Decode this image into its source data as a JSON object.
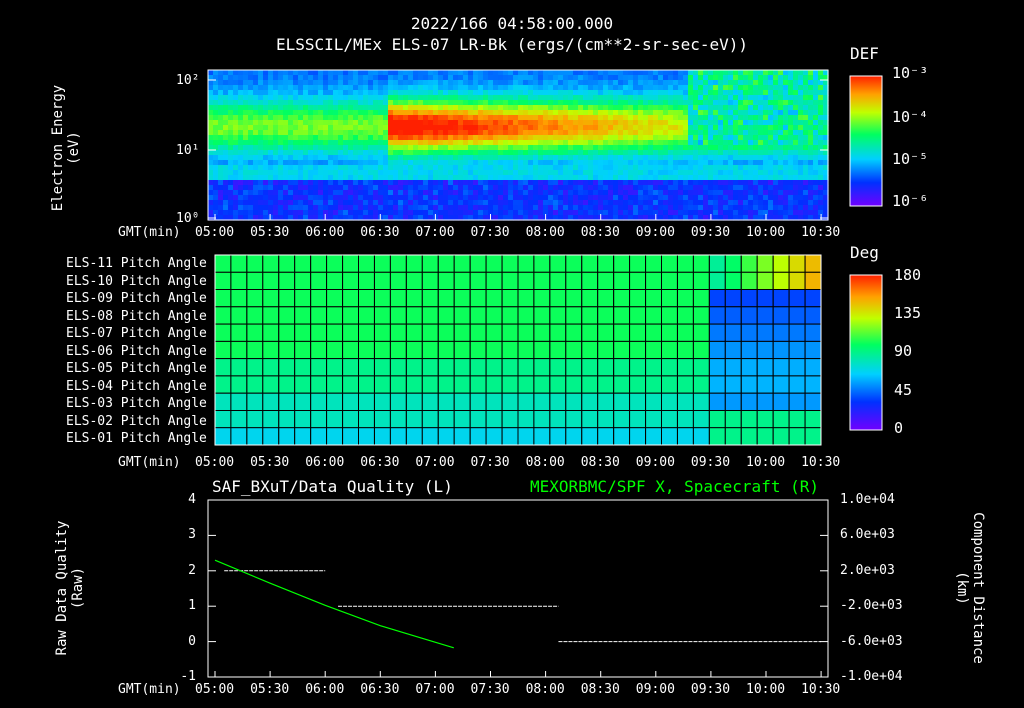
{
  "header": {
    "datetime": "2022/166 04:58:00.000",
    "title": "ELSSCIL/MEx ELS-07 LR-Bk  (ergs/(cm**2-sr-sec-eV))"
  },
  "panel1": {
    "ylabel_line1": "Electron Energy",
    "ylabel_line2": "(eV)",
    "yticks": [
      "10²",
      "10¹",
      "10⁰"
    ],
    "colorbar": {
      "title": "DEF",
      "labels": [
        "10⁻³",
        "10⁻⁴",
        "10⁻⁵",
        "10⁻⁶"
      ]
    }
  },
  "panel2": {
    "rows": [
      "ELS-11 Pitch Angle",
      "ELS-10 Pitch Angle",
      "ELS-09 Pitch Angle",
      "ELS-08 Pitch Angle",
      "ELS-07 Pitch Angle",
      "ELS-06 Pitch Angle",
      "ELS-05 Pitch Angle",
      "ELS-04 Pitch Angle",
      "ELS-03 Pitch Angle",
      "ELS-02 Pitch Angle",
      "ELS-01 Pitch Angle"
    ],
    "colorbar": {
      "title": "Deg",
      "labels": [
        "180",
        "135",
        "90",
        "45",
        "0"
      ]
    }
  },
  "panel3": {
    "title_left": "SAF_BXuT/Data Quality (L)",
    "title_right": "MEXORBMC/SPF X, Spacecraft (R)",
    "title_right_color": "#00ff00",
    "ylabel_left_line1": "Raw Data Quality",
    "ylabel_left_line2": "(Raw)",
    "ylabel_right_line1": "Component Distance",
    "ylabel_right_line2": "(km)",
    "yticks_left": [
      "4",
      "3",
      "2",
      "1",
      "0",
      "-1"
    ],
    "yticks_right": [
      "1.0e+04",
      "6.0e+03",
      "2.0e+03",
      "-2.0e+03",
      "-6.0e+03",
      "-1.0e+04"
    ]
  },
  "time_axis": {
    "label": "GMT(min)",
    "ticks": [
      "05:00",
      "05:30",
      "06:00",
      "06:30",
      "07:00",
      "07:30",
      "08:00",
      "08:30",
      "09:00",
      "09:30",
      "10:00",
      "10:30"
    ]
  },
  "chart_data": [
    {
      "type": "heatmap",
      "title": "ELSSCIL/MEx ELS-07 LR-Bk  (ergs/(cm**2-sr-sec-eV))",
      "ylabel": "Electron Energy (eV)",
      "xlabel": "GMT(min)",
      "x_range": [
        "05:00",
        "10:30"
      ],
      "y_scale": "log",
      "ylim": [
        1,
        150
      ],
      "colorbar_label": "DEF",
      "colorbar_range": [
        1e-06,
        0.001
      ]
    },
    {
      "type": "heatmap",
      "xlabel": "GMT(min)",
      "rows": [
        "ELS-11",
        "ELS-10",
        "ELS-09",
        "ELS-08",
        "ELS-07",
        "ELS-06",
        "ELS-05",
        "ELS-04",
        "ELS-03",
        "ELS-02",
        "ELS-01"
      ],
      "x_range": [
        "05:00",
        "10:30"
      ],
      "colorbar_label": "Deg",
      "colorbar_range": [
        0,
        180
      ]
    },
    {
      "type": "line",
      "title": "SAF_BXuT/Data Quality (L)",
      "xlabel": "GMT(min)",
      "ylabel": "Raw Data Quality (Raw)",
      "ylim": [
        -1,
        4
      ],
      "series": [
        {
          "name": "SAF_BXuT/Data Quality (L)",
          "color": "#ffffff",
          "segments": [
            {
              "x": [
                "05:05",
                "06:00"
              ],
              "y": [
                2,
                2
              ]
            },
            {
              "x": [
                "06:07",
                "08:07"
              ],
              "y": [
                1,
                1
              ]
            },
            {
              "x": [
                "08:07",
                "10:30"
              ],
              "y": [
                0,
                0
              ]
            }
          ]
        },
        {
          "name": "MEXORBMC/SPF X, Spacecraft (R)",
          "color": "#00ff00",
          "axis": "right",
          "x": [
            "05:00",
            "05:30",
            "06:00",
            "06:30",
            "07:10"
          ],
          "y": [
            3200,
            600,
            -1900,
            -4200,
            -6700
          ]
        }
      ],
      "y2label": "Component Distance (km)",
      "y2lim": [
        -10000,
        10000
      ]
    }
  ]
}
